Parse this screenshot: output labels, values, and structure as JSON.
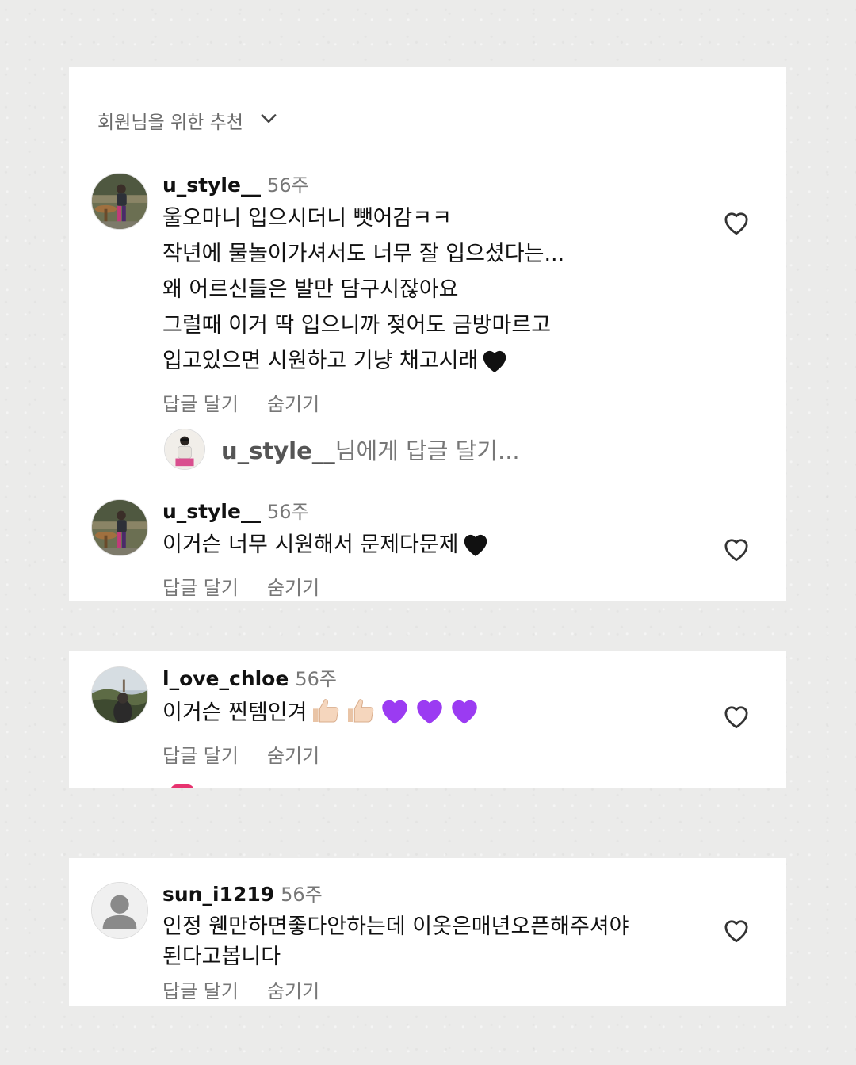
{
  "section_header": {
    "label": "회원님을 위한 추천"
  },
  "comments": [
    {
      "username": "u_style__",
      "time": "56주",
      "lines": [
        "울오마니 입으시더니 뺏어감ㅋㅋ",
        "작년에 물놀이가셔서도 너무 잘 입으셨다는...",
        "왜 어르신들은 발만 담구시잖아요",
        "그럴때 이거 딱 입으니까 젖어도 금방마르고",
        "입고있으면 시원하고 기냥 채고시래"
      ],
      "reply_label": "답글 달기",
      "hide_label": "숨기기"
    },
    {
      "username": "u_style__",
      "time": "56주",
      "lines": [
        "이거슨 너무 시원해서 문제다문제"
      ],
      "reply_label": "답글 달기",
      "hide_label": "숨기기"
    },
    {
      "username": "l_ove_chloe",
      "time": "56주",
      "lines": [
        "이거슨 찐템인겨"
      ],
      "reply_label": "답글 달기",
      "hide_label": "숨기기"
    },
    {
      "username": "sun_i1219",
      "time": "56주",
      "lines": [
        "인정 웬만하면좋다안하는데 이옷은매년오픈해주셔야",
        "된다고봅니다"
      ],
      "reply_label": "답글 달기",
      "hide_label": "숨기기"
    }
  ],
  "reply_input": {
    "mention": "u_style__",
    "placeholder_suffix": "님에게 답글 달기..."
  },
  "icons": {
    "header_chevron": "chevron-down-icon",
    "like": "heart-outline-icon",
    "black_heart": "black-heart-emoji",
    "purple_heart": "purple-heart-emoji",
    "thumbs_up": "thumbs-up-emoji",
    "default_avatar": "person-silhouette-icon"
  },
  "colors": {
    "purple_heart": "#9b3bf2",
    "black_heart": "#111111",
    "thumbs_up": "#f5d6bd",
    "secondary_text": "#777777"
  }
}
